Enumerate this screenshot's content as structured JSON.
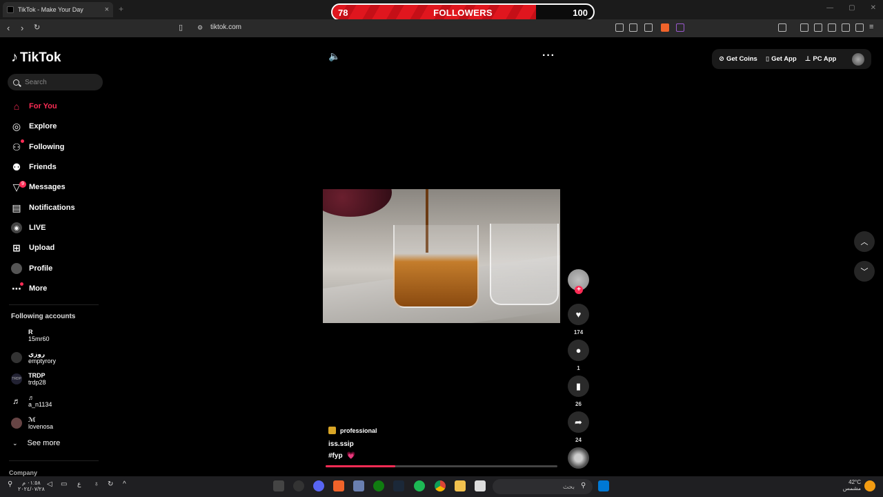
{
  "browser": {
    "tab_title": "TikTok - Make Your Day",
    "tab_close": "×",
    "new_tab": "+",
    "url": "tiktok.com"
  },
  "followers_overlay": {
    "current": "78",
    "label": "FOLLOWERS",
    "goal": "100",
    "progress": 0.78
  },
  "sidebar": {
    "logo": "TikTok",
    "search_placeholder": "Search",
    "nav": [
      {
        "label": "For You",
        "icon": "home-icon"
      },
      {
        "label": "Explore",
        "icon": "compass-icon"
      },
      {
        "label": "Following",
        "icon": "following-icon"
      },
      {
        "label": "Friends",
        "icon": "friends-icon"
      },
      {
        "label": "Messages",
        "icon": "messages-icon",
        "badge": "9"
      },
      {
        "label": "Notifications",
        "icon": "notifications-icon"
      },
      {
        "label": "LIVE",
        "icon": "live-icon"
      },
      {
        "label": "Upload",
        "icon": "upload-icon"
      },
      {
        "label": "Profile",
        "icon": "profile-avatar"
      },
      {
        "label": "More",
        "icon": "more-icon"
      }
    ],
    "following_title": "Following accounts",
    "accounts": [
      {
        "name": "R",
        "handle": "15mr60"
      },
      {
        "name": "روزي",
        "handle": "emptyrory"
      },
      {
        "name": "TRDP",
        "handle": "trdp28"
      },
      {
        "name": "♬",
        "handle": "a_n1134"
      },
      {
        "name": "ℳ",
        "handle": "lovenosa"
      }
    ],
    "see_more": "See more",
    "company": "Company"
  },
  "topright": {
    "get_coins": "Get Coins",
    "get_app": "Get App",
    "pc_app": "PC App"
  },
  "video": {
    "category": "professional",
    "author": "iss.ssip",
    "caption": "#fyp",
    "caption_emoji": "💗",
    "progress": 0.3
  },
  "actions": {
    "likes": "174",
    "comments": "1",
    "saves": "26",
    "shares": "24"
  },
  "taskbar": {
    "search_text": "بحث",
    "time": "٠١:٥٨ م",
    "date": "٢٠٢٤/٠٧/٢٨",
    "temp": "42°C",
    "weather": "مشمس"
  },
  "colors": {
    "accent": "#fe2c55",
    "overlay_red": "#e0161e"
  }
}
